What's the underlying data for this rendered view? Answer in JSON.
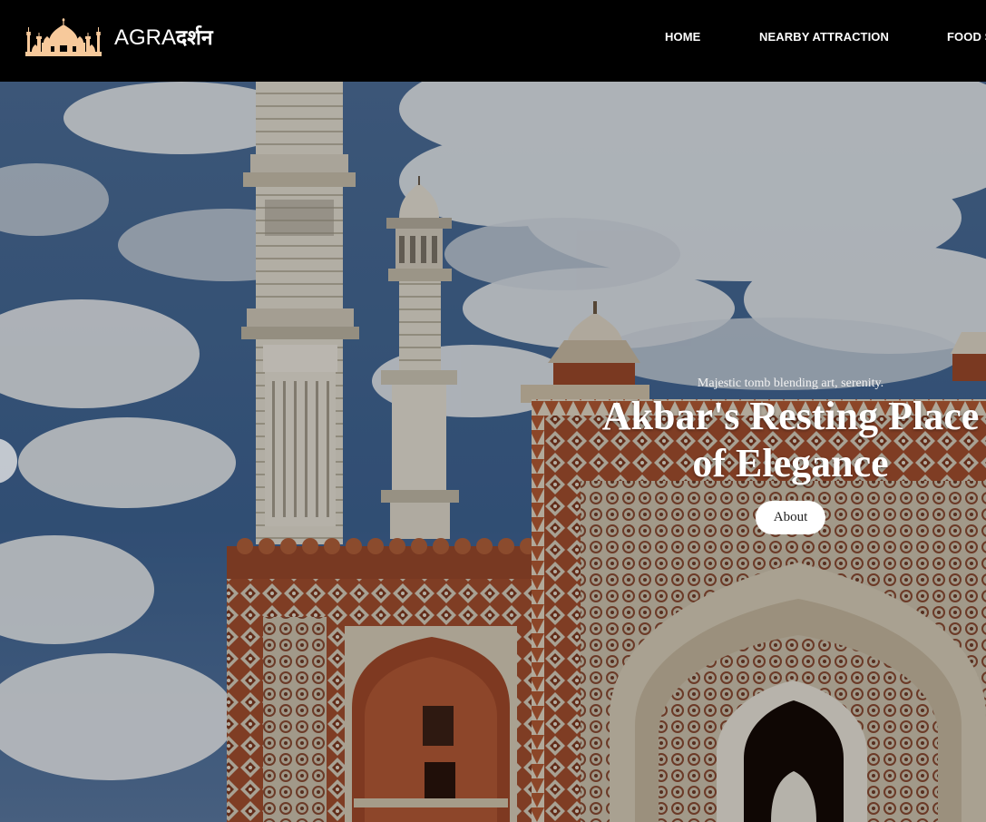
{
  "brand": {
    "latin": "AGRA",
    "devanagari": "दर्शन",
    "logo_icon": "mosque-icon"
  },
  "nav": {
    "home": "HOME",
    "nearby": "NEARBY ATTRACTION",
    "food": "FOOD S"
  },
  "hero": {
    "tagline": "Majestic tomb blending art, serenity.",
    "headline_line1": "Akbar's Resting Place",
    "headline_line2": "of Elegance",
    "button": "About",
    "prev_icon": "chevron-left-icon"
  },
  "colors": {
    "header_bg": "#000000",
    "logo": "#f7c99b",
    "sky": "#3d5f8c",
    "sandstone": "#a24f2e",
    "marble": "#e6e1d4"
  }
}
